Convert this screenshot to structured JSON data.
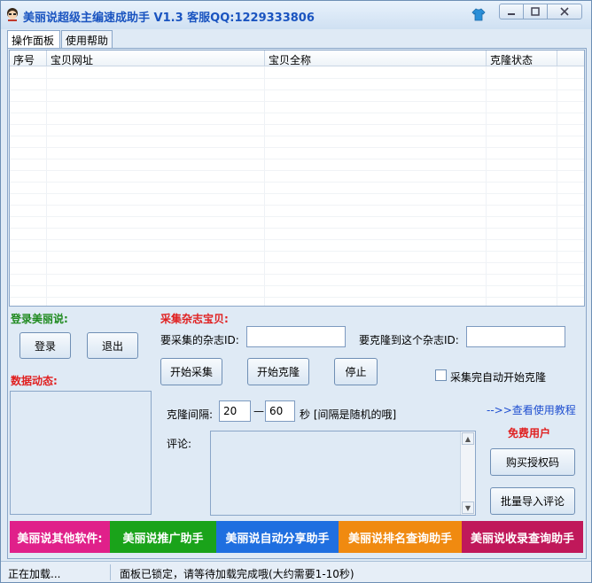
{
  "window": {
    "title": "美丽说超级主编速成助手 V1.3  客服QQ:1229333806"
  },
  "tabs": [
    {
      "label": "操作面板"
    },
    {
      "label": "使用帮助"
    }
  ],
  "grid": {
    "columns": [
      "序号",
      "宝贝网址",
      "宝贝全称",
      "克隆状态"
    ]
  },
  "login": {
    "header": "登录美丽说:",
    "login_btn": "登录",
    "logout_btn": "退出"
  },
  "data_status": {
    "header": "数据动态:"
  },
  "collect": {
    "header": "采集杂志宝贝:",
    "source_id_label": "要采集的杂志ID:",
    "source_id_value": "",
    "target_id_label": "要克隆到这个杂志ID:",
    "target_id_value": "",
    "start_collect_btn": "开始采集",
    "start_clone_btn": "开始克隆",
    "stop_btn": "停止",
    "auto_clone_label": "采集完自动开始克隆"
  },
  "interval": {
    "label": "克隆间隔:",
    "from": "20",
    "dash": "—",
    "to": "60",
    "unit_note": "秒 [间隔是随机的哦]"
  },
  "comment": {
    "label": "评论:"
  },
  "side": {
    "tutorial_link": "-->>查看使用教程",
    "free_user": "免费用户",
    "buy_btn": "购买授权码",
    "import_btn": "批量导入评论"
  },
  "banners": [
    {
      "label": "美丽说其他软件:",
      "color": "#e0208a"
    },
    {
      "label": "美丽说推广助手",
      "color": "#1aa31a"
    },
    {
      "label": "美丽说自动分享助手",
      "color": "#1f6fe0"
    },
    {
      "label": "美丽说排名查询助手",
      "color": "#f08a10"
    },
    {
      "label": "美丽说收录查询助手",
      "color": "#c0185a"
    }
  ],
  "statusbar": {
    "left": "正在加载...",
    "message": "面板已锁定，请等待加载完成哦(大约需要1-10秒)"
  },
  "colors": {
    "title_blue": "#1a54c0",
    "header_green": "#1f8a1f",
    "header_red": "#e02020",
    "link_blue": "#1f4fd0"
  }
}
